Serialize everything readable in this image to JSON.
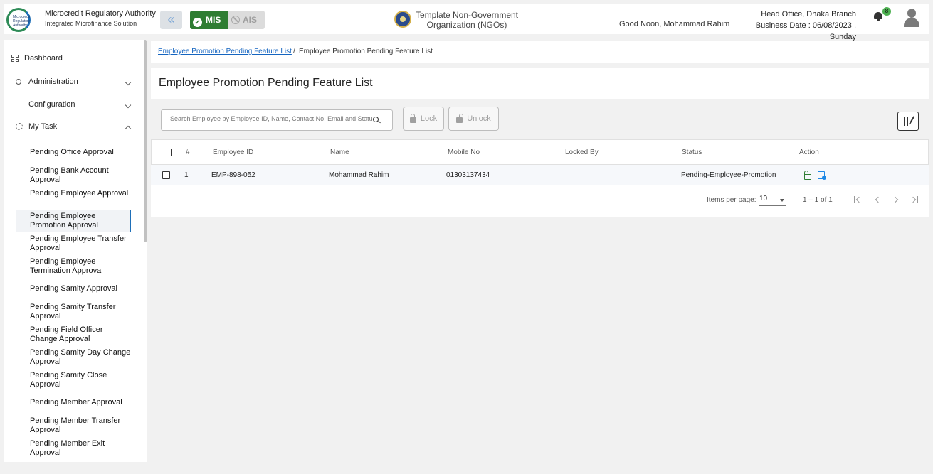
{
  "header": {
    "logo_text": "Microcredit Regulatory Authority",
    "brand_title": "Microcredit Regulatory Authority",
    "brand_subtitle": "Integrated Microfinance Solution",
    "mis_label": "MIS",
    "ais_label": "AIS",
    "org_name": "Template Non-Government Organization (NGOs)",
    "greeting": "Good Noon, Mohammad Rahim",
    "branch": "Head Office, Dhaka Branch",
    "business_date": "Business Date : 06/08/2023 , Sunday",
    "notification_count": "8"
  },
  "sidebar": {
    "dashboard": "Dashboard",
    "administration": "Administration",
    "configuration": "Configuration",
    "my_task": "My Task",
    "items": [
      "Pending Office Approval",
      "Pending Bank Account Approval",
      "Pending Employee Approval",
      "Pending Employee Promotion Approval",
      "Pending Employee Transfer Approval",
      "Pending Employee Termination Approval",
      "Pending Samity Approval",
      "Pending Samity Transfer Approval",
      "Pending Field Officer Change Approval",
      "Pending Samity Day Change Approval",
      "Pending Samity Close Approval",
      "Pending Member Approval",
      "Pending Member Transfer Approval",
      "Pending Member Exit Approval"
    ]
  },
  "breadcrumb": {
    "link": "Employee Promotion Pending Feature List",
    "separator": "/",
    "current": "Employee Promotion Pending Feature List"
  },
  "page_title": "Employee Promotion Pending Feature List",
  "toolbar": {
    "search_placeholder": "Search Employee by Employee ID, Name, Contact No, Email and Status",
    "lock_label": "Lock",
    "unlock_label": "Unlock"
  },
  "table": {
    "columns": [
      "#",
      "Employee ID",
      "Name",
      "Mobile No",
      "Locked By",
      "Status",
      "Action"
    ],
    "rows": [
      {
        "index": "1",
        "employee_id": "EMP-898-052",
        "name": "Mohammad Rahim",
        "mobile": "01303137434",
        "locked_by": "",
        "status": "Pending-Employee-Promotion"
      }
    ]
  },
  "paginator": {
    "items_per_page_label": "Items per page:",
    "items_per_page": "10",
    "range": "1 – 1 of 1"
  },
  "colors": {
    "mis_green": "#2e7d32",
    "link_blue": "#1565c0",
    "active_indicator": "#1e6fb8"
  }
}
